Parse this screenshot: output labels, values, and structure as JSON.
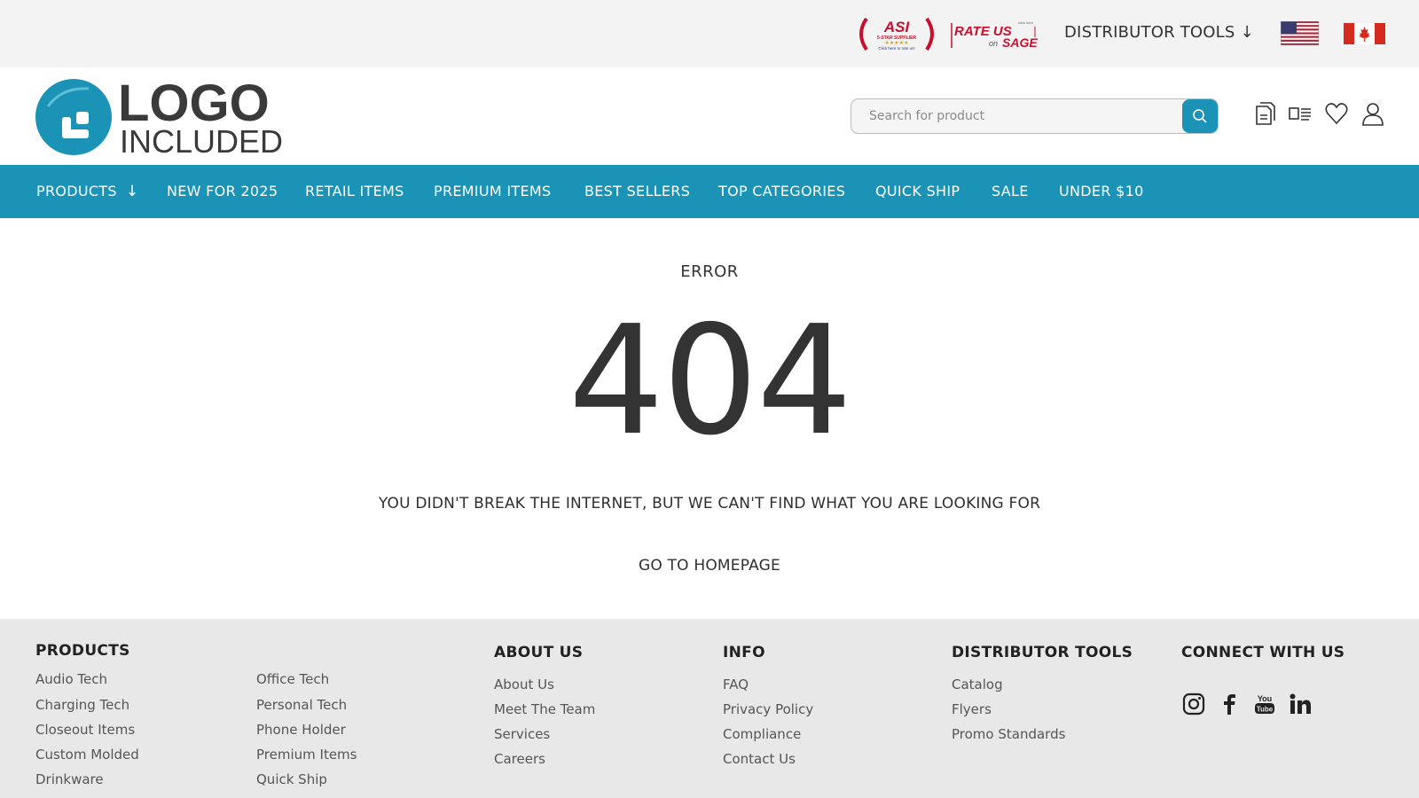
{
  "topbar": {
    "asi_badge": {
      "main": "ASI",
      "stars_text": "5-STAR SUPPLIER",
      "sub": "Click here to rate us!"
    },
    "sage_badge": {
      "rate": "RATE US",
      "on": "on",
      "brand": "SAGE",
      "corner": "click here"
    },
    "distributor_tools_label": "DISTRIBUTOR TOOLS",
    "flag_us": "us-flag-icon",
    "flag_ca": "ca-flag-icon"
  },
  "header": {
    "logo_line1": "LOGO",
    "logo_line2": "INCLUDED",
    "search_placeholder": "Search for product",
    "icons": [
      "catalog-icon",
      "compare-icon",
      "heart-icon",
      "user-icon"
    ]
  },
  "nav": {
    "items": [
      {
        "label": "PRODUCTS"
      },
      {
        "label": "NEW FOR 2025"
      },
      {
        "label": "RETAIL ITEMS"
      },
      {
        "label": "PREMIUM ITEMS"
      },
      {
        "label": "BEST SELLERS"
      },
      {
        "label": "TOP CATEGORIES"
      },
      {
        "label": "QUICK SHIP"
      },
      {
        "label": "SALE"
      },
      {
        "label": "UNDER $10"
      }
    ]
  },
  "error": {
    "label": "ERROR",
    "code": "404",
    "message": "YOU DIDN'T BREAK THE INTERNET, BUT WE CAN'T FIND WHAT YOU ARE LOOKING FOR",
    "home_link": "GO TO HOMEPAGE"
  },
  "footer": {
    "products": {
      "heading": "PRODUCTS",
      "col1": [
        "Audio Tech",
        "Charging Tech",
        "Closeout Items",
        "Custom Molded",
        "Drinkware"
      ],
      "col2": [
        "Office Tech",
        "Personal Tech",
        "Phone Holder",
        "Premium Items",
        "Quick Ship"
      ]
    },
    "about": {
      "heading": "ABOUT US",
      "links": [
        "About Us",
        "Meet The Team",
        "Services",
        "Careers"
      ]
    },
    "info": {
      "heading": "INFO",
      "links": [
        "FAQ",
        "Privacy Policy",
        "Compliance",
        "Contact Us"
      ]
    },
    "distributor": {
      "heading": "DISTRIBUTOR TOOLS",
      "links": [
        "Catalog",
        "Flyers",
        "Promo Standards"
      ]
    },
    "connect": {
      "heading": "CONNECT WITH US",
      "icons": [
        "instagram-icon",
        "facebook-icon",
        "youtube-icon",
        "linkedin-icon"
      ]
    }
  },
  "colors": {
    "brand": "#1a93b7",
    "text": "#333333",
    "footer_bg": "#e8e8e8",
    "topbar_bg": "#f3f3f3"
  }
}
